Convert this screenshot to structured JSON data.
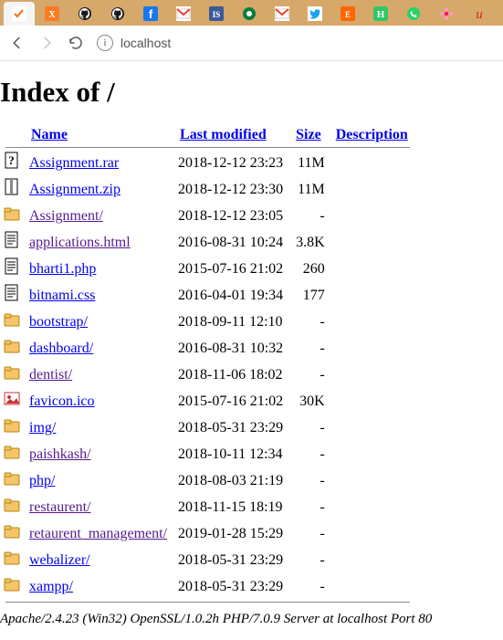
{
  "browser": {
    "url": "localhost",
    "tabs": [
      {
        "icon": "check-orange",
        "active": true
      },
      {
        "icon": "xampp",
        "active": false
      },
      {
        "icon": "github",
        "active": false
      },
      {
        "icon": "github",
        "active": false
      },
      {
        "icon": "facebook",
        "active": false
      },
      {
        "icon": "gmail",
        "active": false
      },
      {
        "icon": "is-blue",
        "active": false
      },
      {
        "icon": "green-dot",
        "active": false
      },
      {
        "icon": "gmail",
        "active": false
      },
      {
        "icon": "twitter",
        "active": false
      },
      {
        "icon": "eh-orange",
        "active": false
      },
      {
        "icon": "h-green",
        "active": false
      },
      {
        "icon": "whatsapp",
        "active": false
      },
      {
        "icon": "flower",
        "active": false
      },
      {
        "icon": "u-red",
        "active": false
      }
    ]
  },
  "page": {
    "heading": "Index of /",
    "columns": {
      "name": "Name",
      "modified": "Last modified",
      "size": "Size",
      "description": "Description"
    },
    "rows": [
      {
        "icon": "unknown",
        "name": "Assignment.rar",
        "href": "#",
        "visited": false,
        "modified": "2018-12-12 23:23",
        "size": "11M"
      },
      {
        "icon": "compressed",
        "name": "Assignment.zip",
        "href": "#",
        "visited": false,
        "modified": "2018-12-12 23:30",
        "size": "11M"
      },
      {
        "icon": "folder",
        "name": "Assignment/",
        "href": "#",
        "visited": true,
        "modified": "2018-12-12 23:05",
        "size": "-"
      },
      {
        "icon": "text",
        "name": "applications.html",
        "href": "#",
        "visited": true,
        "modified": "2016-08-31 10:24",
        "size": "3.8K"
      },
      {
        "icon": "text",
        "name": "bharti1.php",
        "href": "#",
        "visited": false,
        "modified": "2015-07-16 21:02",
        "size": "260"
      },
      {
        "icon": "text",
        "name": "bitnami.css",
        "href": "#",
        "visited": false,
        "modified": "2016-04-01 19:34",
        "size": "177"
      },
      {
        "icon": "folder",
        "name": "bootstrap/",
        "href": "#",
        "visited": false,
        "modified": "2018-09-11 12:10",
        "size": "-"
      },
      {
        "icon": "folder",
        "name": "dashboard/",
        "href": "#",
        "visited": false,
        "modified": "2016-08-31 10:32",
        "size": "-"
      },
      {
        "icon": "folder",
        "name": "dentist/",
        "href": "#",
        "visited": true,
        "modified": "2018-11-06 18:02",
        "size": "-"
      },
      {
        "icon": "image",
        "name": "favicon.ico",
        "href": "#",
        "visited": false,
        "modified": "2015-07-16 21:02",
        "size": "30K"
      },
      {
        "icon": "folder",
        "name": "img/",
        "href": "#",
        "visited": false,
        "modified": "2018-05-31 23:29",
        "size": "-"
      },
      {
        "icon": "folder",
        "name": "paishkash/",
        "href": "#",
        "visited": true,
        "modified": "2018-10-11 12:34",
        "size": "-"
      },
      {
        "icon": "folder",
        "name": "php/",
        "href": "#",
        "visited": false,
        "modified": "2018-08-03 21:19",
        "size": "-"
      },
      {
        "icon": "folder",
        "name": "restaurent/",
        "href": "#",
        "visited": true,
        "modified": "2018-11-15 18:19",
        "size": "-"
      },
      {
        "icon": "folder",
        "name": "retaurent_management/",
        "href": "#",
        "visited": true,
        "modified": "2019-01-28 15:29",
        "size": "-"
      },
      {
        "icon": "folder",
        "name": "webalizer/",
        "href": "#",
        "visited": false,
        "modified": "2018-05-31 23:29",
        "size": "-"
      },
      {
        "icon": "folder",
        "name": "xampp/",
        "href": "#",
        "visited": false,
        "modified": "2018-05-31 23:29",
        "size": "-"
      }
    ],
    "footer": "Apache/2.4.23 (Win32) OpenSSL/1.0.2h PHP/7.0.9 Server at localhost Port 80"
  }
}
